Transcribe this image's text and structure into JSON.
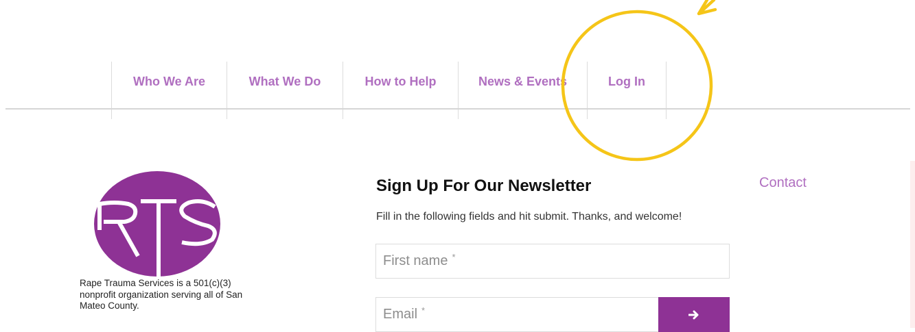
{
  "nav": {
    "items": [
      {
        "label": "Who We Are"
      },
      {
        "label": "What We Do"
      },
      {
        "label": "How to Help"
      },
      {
        "label": "News & Events"
      },
      {
        "label": "Log In"
      }
    ]
  },
  "logo": {
    "letters": "RTS",
    "color": "#8e3295"
  },
  "footer": {
    "mission_brand": "Rape Trauma Services",
    "mission_text": " is a 501(c)(3) nonprofit organization serving all of San Mateo County.",
    "newsletter": {
      "title": "Sign Up For Our Newsletter",
      "subtitle": "Fill in the following fields and hit submit. Thanks, and welcome!",
      "first_name_placeholder": "First name",
      "email_placeholder": "Email",
      "required_mark": "*",
      "submit_icon": "arrow-right-icon"
    },
    "contact_label": "Contact"
  },
  "colors": {
    "accent": "#b06fc0",
    "brand": "#8e3295",
    "annotation": "#f5c518"
  }
}
